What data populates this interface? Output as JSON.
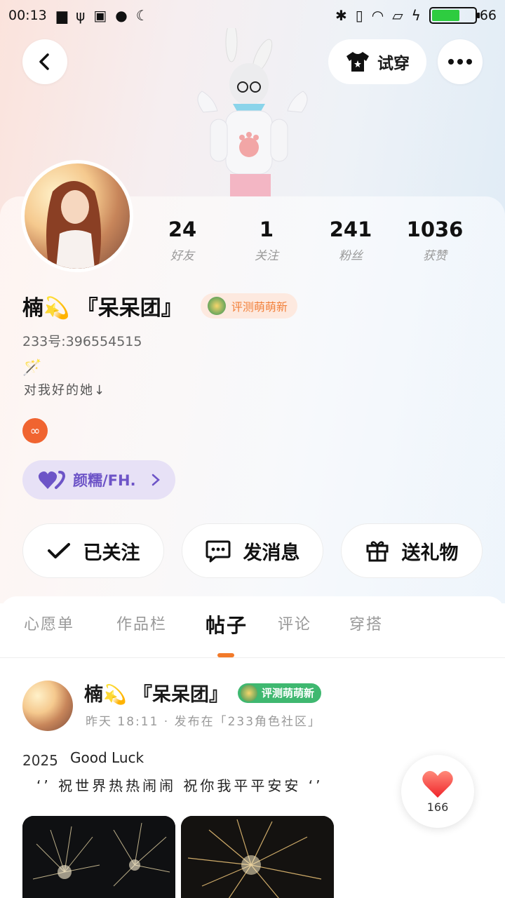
{
  "status_bar": {
    "time": "00:13",
    "battery": "66"
  },
  "header": {
    "try_on_label": "试穿"
  },
  "stats": [
    {
      "num": "24",
      "label": "好友"
    },
    {
      "num": "1",
      "label": "关注"
    },
    {
      "num": "241",
      "label": "粉丝"
    },
    {
      "num": "1036",
      "label": "获赞"
    }
  ],
  "profile": {
    "name": "楠💫 『呆呆团』",
    "badge": "评测萌萌新",
    "uid": "233号:396554515",
    "bio_emoji": "🪄",
    "bio": "对我好的她↓",
    "group_label": "颜糯/FH."
  },
  "actions": {
    "followed": "已关注",
    "message": "发消息",
    "gift": "送礼物"
  },
  "tabs": [
    "心愿单",
    "作品栏",
    "帖子",
    "评论",
    "穿搭"
  ],
  "post": {
    "author": "楠💫 『呆呆团』",
    "badge": "评测萌萌新",
    "meta": "昨天 18:11 · 发布在「233角色社区」",
    "year": "2025",
    "title": "Good Luck",
    "line": "‘’ 祝世界热热闹闹 祝你我平平安安 ‘’",
    "likes": "166"
  },
  "colors": {
    "accent": "#f27a2a",
    "group": "#6d54c7",
    "badge_green": "#3fb870"
  }
}
